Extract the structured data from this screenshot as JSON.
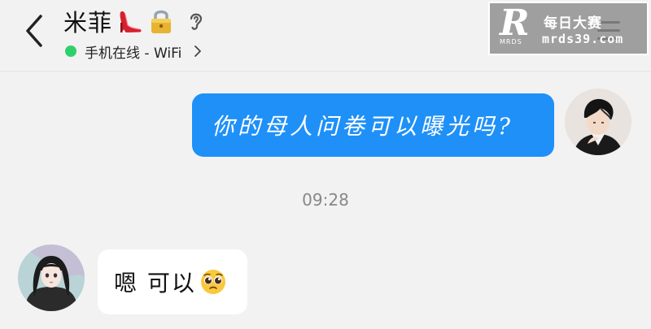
{
  "header": {
    "contact_name": "米菲",
    "title_icons": [
      "high-heel-emoji",
      "lock-emoji",
      "ear-icon"
    ],
    "status_text": "手机在线 - WiFi",
    "status_color": "#2fd06b"
  },
  "watermark": {
    "logo_letter": "R",
    "logo_sub": "MRDS",
    "name_cn": "每日大赛",
    "domain": "mrds39.com"
  },
  "messages": [
    {
      "direction": "outgoing",
      "text": "你的母人问卷可以曝光吗?",
      "bubble_color": "#1e90f8"
    },
    {
      "direction": "timestamp",
      "text": "09:28"
    },
    {
      "direction": "incoming",
      "text": "嗯 可以",
      "emoji": "pleading-face-emoji",
      "bubble_color": "#ffffff"
    }
  ]
}
